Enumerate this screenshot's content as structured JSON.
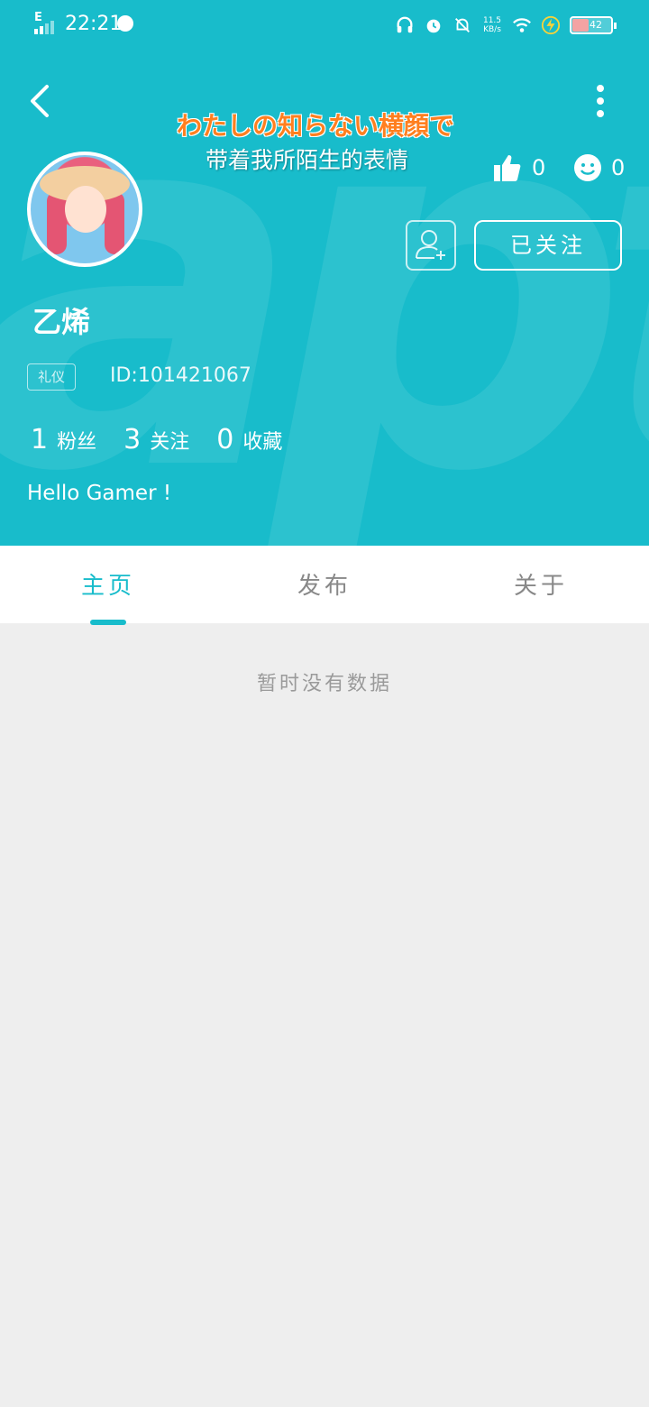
{
  "status_bar": {
    "network": "E",
    "time": "22:21",
    "speed_value": "11.5",
    "speed_unit": "KB/s",
    "battery_level": "42"
  },
  "header": {
    "lyric_line1": "わたしの知らない横顔で",
    "lyric_line2": "带着我所陌生的表情",
    "likes": "0",
    "emoji_count": "0",
    "follow_button": "已关注",
    "username": "乙烯",
    "badge": "礼仪",
    "user_id": "ID:101421067",
    "counts": [
      {
        "value": "1",
        "label": "粉丝"
      },
      {
        "value": "3",
        "label": "关注"
      },
      {
        "value": "0",
        "label": "收藏"
      }
    ],
    "bio": "Hello Gamer !",
    "theme_color": "#18bccb"
  },
  "tabs": [
    {
      "label": "主页",
      "active": true
    },
    {
      "label": "发布",
      "active": false
    },
    {
      "label": "关于",
      "active": false
    }
  ],
  "content": {
    "empty_message": "暂时没有数据"
  }
}
